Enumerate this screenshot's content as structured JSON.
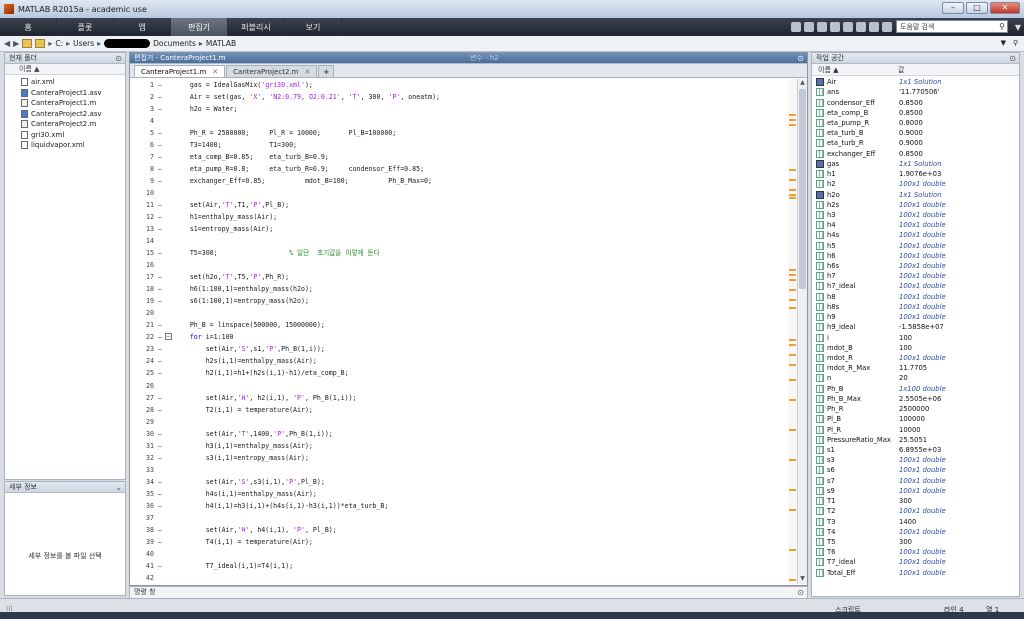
{
  "window": {
    "title": "MATLAB R2015a - academic use"
  },
  "ribbon": {
    "tabs": [
      "홈",
      "플롯",
      "앱",
      "편집기",
      "퍼블리시",
      "보기"
    ],
    "active": 3,
    "search_placeholder": "도움말 검색"
  },
  "address": {
    "path": [
      "C:",
      "Users",
      "Documents",
      "MATLAB"
    ]
  },
  "current_folder": {
    "title": "현재 폴더",
    "column": "이름 ▲",
    "files": [
      {
        "name": "air.xml",
        "type": "xml"
      },
      {
        "name": "CanteraProject1.asv",
        "type": "asv"
      },
      {
        "name": "CanteraProject1.m",
        "type": "m"
      },
      {
        "name": "CanteraProject2.asv",
        "type": "asv"
      },
      {
        "name": "CanteraProject2.m",
        "type": "m"
      },
      {
        "name": "gri30.xml",
        "type": "xml"
      },
      {
        "name": "liquidvapor.xml",
        "type": "xml"
      }
    ]
  },
  "details": {
    "title": "세부 정보",
    "message": "세부 정보를 볼 파일 선택"
  },
  "editor": {
    "title": "편집기 - CanteraProject1.m",
    "var_hint": "변수 - h2",
    "tabs": [
      "CanteraProject1.m",
      "CanteraProject2.m"
    ],
    "lines": [
      {
        "n": "1",
        "d": "–",
        "t": "gas = IdealGasMix('gri30.xml');"
      },
      {
        "n": "2",
        "d": "–",
        "t": "Air = set(gas, 'X', 'N2:0.79, O2:0.21', 'T', 300, 'P', oneatm);"
      },
      {
        "n": "3",
        "d": "–",
        "t": "h2o = Water;"
      },
      {
        "n": "4",
        "d": "",
        "t": ""
      },
      {
        "n": "5",
        "d": "–",
        "t": "Ph_R = 2500000;     Pl_R = 10000;       Pl_B=100000;"
      },
      {
        "n": "6",
        "d": "–",
        "t": "T3=1400;            T1=300;"
      },
      {
        "n": "7",
        "d": "–",
        "t": "eta_comp_B=0.85;    eta_turb_B=0.9;"
      },
      {
        "n": "8",
        "d": "–",
        "t": "eta_pump_R=0.8;     eta_turb_R=0.9;     condensor_Eff=0.85;"
      },
      {
        "n": "9",
        "d": "–",
        "t": "exchanger_Eff=0.85;          mdot_B=100;          Ph_B_Max=0;"
      },
      {
        "n": "10",
        "d": "",
        "t": ""
      },
      {
        "n": "11",
        "d": "–",
        "t": "set(Air,'T',T1,'P',Pl_B);"
      },
      {
        "n": "12",
        "d": "–",
        "t": "h1=enthalpy_mass(Air);"
      },
      {
        "n": "13",
        "d": "–",
        "t": "s1=entropy_mass(Air);"
      },
      {
        "n": "14",
        "d": "",
        "t": ""
      },
      {
        "n": "15",
        "d": "–",
        "t": "T5=300;                  % 일단  초기값을 이렇게 둔다"
      },
      {
        "n": "16",
        "d": "",
        "t": ""
      },
      {
        "n": "17",
        "d": "–",
        "t": "set(h2o,'T',T5,'P',Ph_R);"
      },
      {
        "n": "18",
        "d": "–",
        "t": "h6(1:100,1)=enthalpy_mass(h2o);"
      },
      {
        "n": "19",
        "d": "–",
        "t": "s6(1:100,1)=entropy_mass(h2o);"
      },
      {
        "n": "20",
        "d": "",
        "t": ""
      },
      {
        "n": "21",
        "d": "–",
        "t": "Ph_B = linspace(500000, 15000000);"
      },
      {
        "n": "22",
        "d": "–",
        "t": "for i=1:100"
      },
      {
        "n": "23",
        "d": "–",
        "t": "    set(Air,'S',s1,'P',Ph_B(1,i));"
      },
      {
        "n": "24",
        "d": "–",
        "t": "    h2s(i,1)=enthalpy_mass(Air);"
      },
      {
        "n": "25",
        "d": "–",
        "t": "    h2(i,1)=h1+(h2s(i,1)-h1)/eta_comp_B;"
      },
      {
        "n": "26",
        "d": "",
        "t": ""
      },
      {
        "n": "27",
        "d": "–",
        "t": "    set(Air,'H', h2(i,1), 'P', Ph_B(1,i));"
      },
      {
        "n": "28",
        "d": "–",
        "t": "    T2(i,1) = temperature(Air);"
      },
      {
        "n": "29",
        "d": "",
        "t": ""
      },
      {
        "n": "30",
        "d": "–",
        "t": "    set(Air,'T',1400,'P',Ph_B(1,i));"
      },
      {
        "n": "31",
        "d": "–",
        "t": "    h3(i,1)=enthalpy_mass(Air);"
      },
      {
        "n": "32",
        "d": "–",
        "t": "    s3(i,1)=entropy_mass(Air);"
      },
      {
        "n": "33",
        "d": "",
        "t": ""
      },
      {
        "n": "34",
        "d": "–",
        "t": "    set(Air,'S',s3(i,1),'P',Pl_B);"
      },
      {
        "n": "35",
        "d": "–",
        "t": "    h4s(i,1)=enthalpy_mass(Air);"
      },
      {
        "n": "36",
        "d": "–",
        "t": "    h4(i,1)=h3(i,1)+(h4s(i,1)-h3(i,1))*eta_turb_B;"
      },
      {
        "n": "37",
        "d": "",
        "t": ""
      },
      {
        "n": "38",
        "d": "–",
        "t": "    set(Air,'H', h4(i,1), 'P', Pl_B);"
      },
      {
        "n": "39",
        "d": "–",
        "t": "    T4(i,1) = temperature(Air);"
      },
      {
        "n": "40",
        "d": "",
        "t": ""
      },
      {
        "n": "41",
        "d": "–",
        "t": "    T7_ideal(i,1)=T4(i,1);"
      },
      {
        "n": "42",
        "d": "",
        "t": ""
      }
    ]
  },
  "command_window": {
    "title": "명령 창"
  },
  "workspace": {
    "title": "작업 공간",
    "columns": [
      "이름 ▲",
      "값"
    ],
    "vars": [
      {
        "name": "Air",
        "value": "1x1 Solution",
        "kind": "obj"
      },
      {
        "name": "ans",
        "value": "'11.770506'",
        "kind": "arr"
      },
      {
        "name": "condensor_Eff",
        "value": "0.8500",
        "kind": "arr"
      },
      {
        "name": "eta_comp_B",
        "value": "0.8500",
        "kind": "arr"
      },
      {
        "name": "eta_pump_R",
        "value": "0.8000",
        "kind": "arr"
      },
      {
        "name": "eta_turb_B",
        "value": "0.9000",
        "kind": "arr"
      },
      {
        "name": "eta_turb_R",
        "value": "0.9000",
        "kind": "arr"
      },
      {
        "name": "exchanger_Eff",
        "value": "0.8500",
        "kind": "arr"
      },
      {
        "name": "gas",
        "value": "1x1 Solution",
        "kind": "obj"
      },
      {
        "name": "h1",
        "value": "1.9076e+03",
        "kind": "arr"
      },
      {
        "name": "h2",
        "value": "100x1 double",
        "kind": "arr"
      },
      {
        "name": "h2o",
        "value": "1x1 Solution",
        "kind": "obj"
      },
      {
        "name": "h2s",
        "value": "100x1 double",
        "kind": "arr"
      },
      {
        "name": "h3",
        "value": "100x1 double",
        "kind": "arr"
      },
      {
        "name": "h4",
        "value": "100x1 double",
        "kind": "arr"
      },
      {
        "name": "h4s",
        "value": "100x1 double",
        "kind": "arr"
      },
      {
        "name": "h5",
        "value": "100x1 double",
        "kind": "arr"
      },
      {
        "name": "h6",
        "value": "100x1 double",
        "kind": "arr"
      },
      {
        "name": "h6s",
        "value": "100x1 double",
        "kind": "arr"
      },
      {
        "name": "h7",
        "value": "100x1 double",
        "kind": "arr"
      },
      {
        "name": "h7_ideal",
        "value": "100x1 double",
        "kind": "arr"
      },
      {
        "name": "h8",
        "value": "100x1 double",
        "kind": "arr"
      },
      {
        "name": "h8s",
        "value": "100x1 double",
        "kind": "arr"
      },
      {
        "name": "h9",
        "value": "100x1 double",
        "kind": "arr"
      },
      {
        "name": "h9_ideal",
        "value": "-1.5858e+07",
        "kind": "arr"
      },
      {
        "name": "i",
        "value": "100",
        "kind": "arr"
      },
      {
        "name": "mdot_B",
        "value": "100",
        "kind": "arr"
      },
      {
        "name": "mdot_R",
        "value": "100x1 double",
        "kind": "arr"
      },
      {
        "name": "mdot_R_Max",
        "value": "11.7705",
        "kind": "arr"
      },
      {
        "name": "n",
        "value": "20",
        "kind": "arr"
      },
      {
        "name": "Ph_B",
        "value": "1x100 double",
        "kind": "arr"
      },
      {
        "name": "Ph_B_Max",
        "value": "2.5505e+06",
        "kind": "arr"
      },
      {
        "name": "Ph_R",
        "value": "2500000",
        "kind": "arr"
      },
      {
        "name": "Pl_B",
        "value": "100000",
        "kind": "arr"
      },
      {
        "name": "Pl_R",
        "value": "10000",
        "kind": "arr"
      },
      {
        "name": "PressureRatio_Max",
        "value": "25.5051",
        "kind": "arr"
      },
      {
        "name": "s1",
        "value": "6.8955e+03",
        "kind": "arr"
      },
      {
        "name": "s3",
        "value": "100x1 double",
        "kind": "arr"
      },
      {
        "name": "s6",
        "value": "100x1 double",
        "kind": "arr"
      },
      {
        "name": "s7",
        "value": "100x1 double",
        "kind": "arr"
      },
      {
        "name": "s9",
        "value": "100x1 double",
        "kind": "arr"
      },
      {
        "name": "T1",
        "value": "300",
        "kind": "arr"
      },
      {
        "name": "T2",
        "value": "100x1 double",
        "kind": "arr"
      },
      {
        "name": "T3",
        "value": "1400",
        "kind": "arr"
      },
      {
        "name": "T4",
        "value": "100x1 double",
        "kind": "arr"
      },
      {
        "name": "T5",
        "value": "300",
        "kind": "arr"
      },
      {
        "name": "T6",
        "value": "100x1 double",
        "kind": "arr"
      },
      {
        "name": "T7_ideal",
        "value": "100x1 double",
        "kind": "arr"
      },
      {
        "name": "Total_Eff",
        "value": "100x1 double",
        "kind": "arr"
      }
    ]
  },
  "statusbar": {
    "script": "스크립트",
    "line_label": "라인",
    "line": "4",
    "col_label": "열",
    "col": "1"
  }
}
